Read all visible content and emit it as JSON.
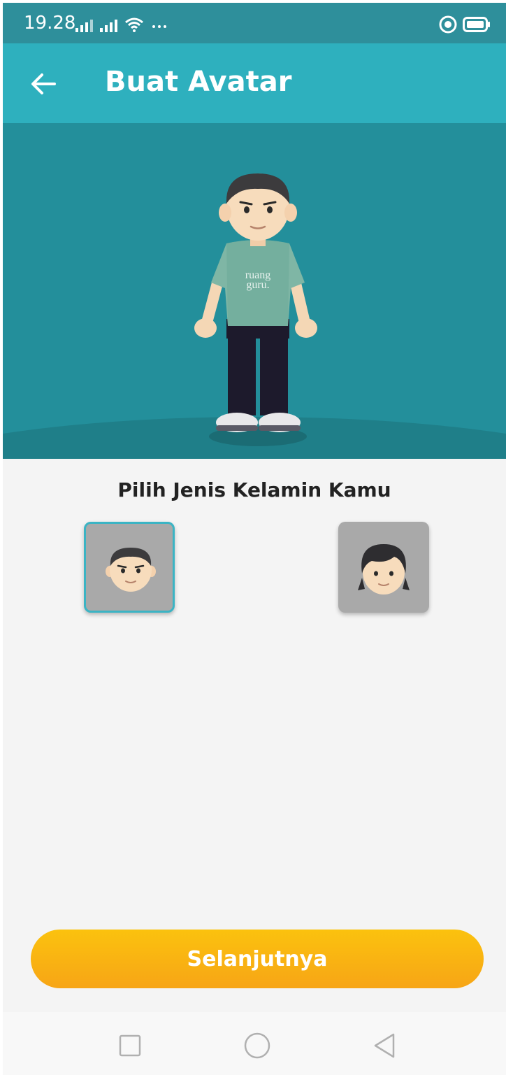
{
  "status_bar": {
    "time": "19.28",
    "icons": [
      "signal-icon",
      "signal-icon",
      "wifi-icon",
      "more-icon",
      "focus-icon",
      "battery-icon"
    ]
  },
  "app_bar": {
    "title": "Buat Avatar",
    "back_icon": "arrow-left-icon"
  },
  "main": {
    "prompt": "Pilih Jenis Kelamin Kamu",
    "options": [
      {
        "name": "male",
        "selected": true
      },
      {
        "name": "female",
        "selected": false
      }
    ],
    "next_button": "Selanjutnya"
  },
  "colors": {
    "app_bar": "#2eb0be",
    "hero_bg": "#238f9b",
    "button": "#f9b414",
    "selected_border": "#3bb4c4"
  },
  "nav_bar": {
    "icons": [
      "recent-apps-icon",
      "home-icon",
      "back-icon"
    ]
  }
}
